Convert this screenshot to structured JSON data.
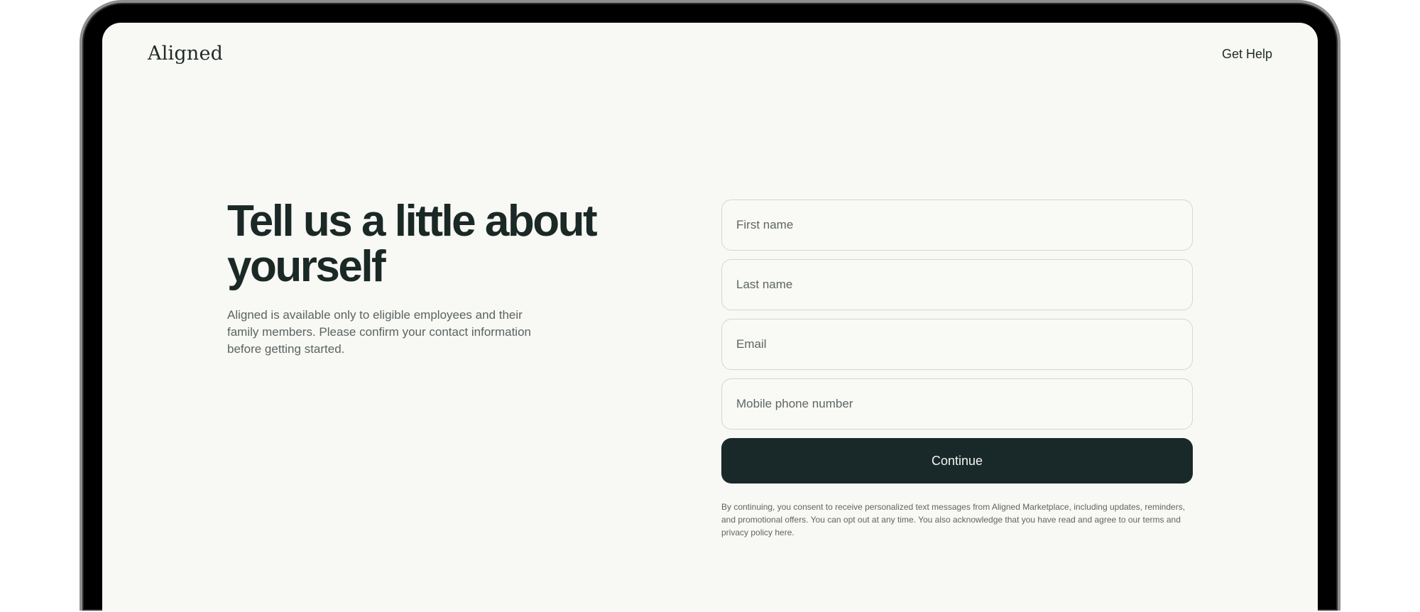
{
  "header": {
    "logo_text": "Aligned",
    "help_link": "Get Help"
  },
  "intro": {
    "headline": "Tell us a little about yourself",
    "description": "Aligned is available only to eligible employees and their family members. Please confirm your contact information before getting started."
  },
  "form": {
    "first_name": {
      "placeholder": "First name",
      "value": ""
    },
    "last_name": {
      "placeholder": "Last name",
      "value": ""
    },
    "email": {
      "placeholder": "Email",
      "value": ""
    },
    "phone": {
      "placeholder": "Mobile phone number",
      "value": ""
    },
    "submit_label": "Continue",
    "disclaimer": "By continuing, you consent to receive personalized text messages from Aligned Marketplace, including updates, reminders, and promotional offers. You can opt out at any time. You also acknowledge that you have read and agree to our terms and privacy policy here."
  },
  "colors": {
    "background": "#f8f8f4",
    "primary_button": "#19292a",
    "text_dark": "#1a2826",
    "text_muted": "#5b6463"
  }
}
